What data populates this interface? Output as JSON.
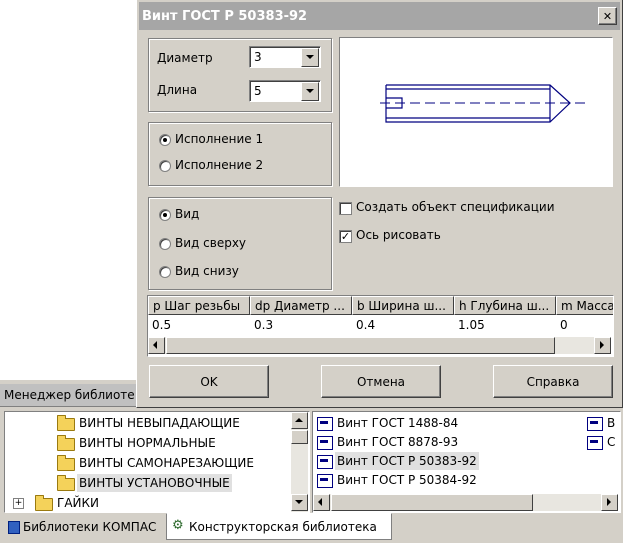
{
  "dialog": {
    "title": "Винт ГОСТ Р 50383-92",
    "close_glyph": "✕",
    "params": {
      "diameter_label": "Диаметр",
      "diameter_value": "3",
      "length_label": "Длина",
      "length_value": "5"
    },
    "execution": {
      "option1": "Исполнение 1",
      "option2": "Исполнение 2",
      "selected": 1
    },
    "view": {
      "option1": "Вид",
      "option2": "Вид сверху",
      "option3": "Вид снизу",
      "selected": 1
    },
    "checkboxes": {
      "create_spec_label": "Создать объект спецификации",
      "create_spec_checked": false,
      "draw_axis_label": "Ось рисовать",
      "draw_axis_checked": true
    },
    "table": {
      "headers": [
        "p Шаг резьбы",
        "dp Диаметр ...",
        "b Ширина ш...",
        "h Глубина ш...",
        "m Масса"
      ],
      "row": [
        "0.5",
        "0.3",
        "0.4",
        "1.05",
        "0"
      ]
    },
    "buttons": {
      "ok": "OK",
      "cancel": "Отмена",
      "help": "Справка"
    }
  },
  "manager": {
    "title": "Менеджер библиоте",
    "tree": [
      {
        "label": "ВИНТЫ НЕВЫПАДАЮЩИЕ"
      },
      {
        "label": "ВИНТЫ НОРМАЛЬНЫЕ"
      },
      {
        "label": "ВИНТЫ САМОНАРЕЗАЮЩИЕ"
      },
      {
        "label": "ВИНТЫ УСТАНОВОЧНЫЕ"
      },
      {
        "label": "ГАЙКИ",
        "expander": "+"
      }
    ],
    "list": [
      {
        "label": "Винт ГОСТ 1488-84"
      },
      {
        "label": "Винт ГОСТ 8878-93"
      },
      {
        "label": "Винт ГОСТ Р 50383-92"
      },
      {
        "label": "Винт ГОСТ Р 50384-92"
      }
    ],
    "right_partial": [
      "В",
      "С"
    ],
    "tabs": [
      {
        "label": "Библиотеки КОМПАС"
      },
      {
        "label": "Конструкторская библиотека"
      }
    ]
  },
  "colors": {
    "titlebar": "#a6a6a6",
    "dialog_bg": "#d4d0c8",
    "selected_bg": "#e0e0e0",
    "drawing_stroke": "#000080"
  }
}
